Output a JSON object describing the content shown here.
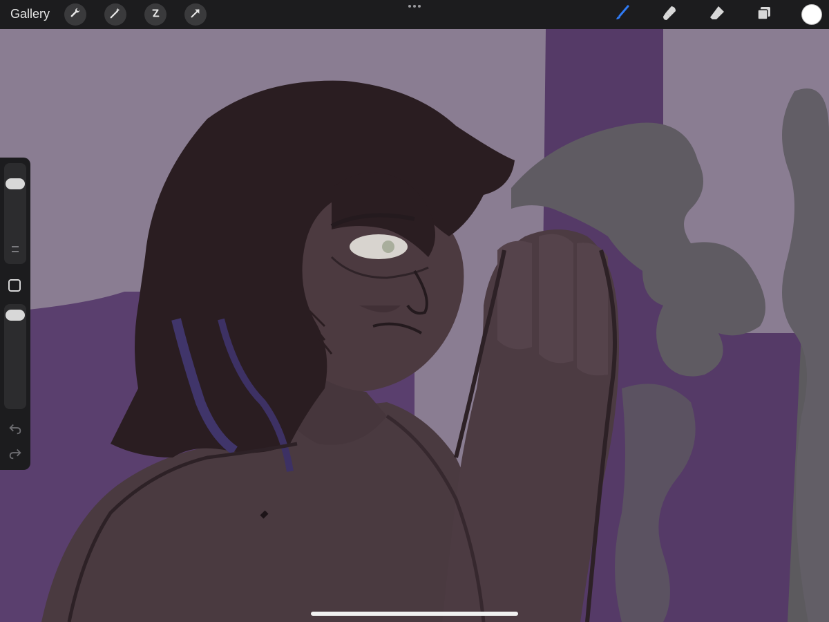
{
  "toolbar": {
    "gallery_label": "Gallery",
    "left_tools": [
      "wrench-icon",
      "magic-wand-icon",
      "selection-icon",
      "transform-arrow-icon"
    ],
    "right_tools": [
      "brush-icon",
      "smudge-icon",
      "eraser-icon",
      "layers-icon"
    ],
    "active_tool": "brush-icon",
    "active_color": "#ffffff",
    "accent_color": "#2f7bf5"
  },
  "sidebar": {
    "controls": [
      "brush-size-slider",
      "modify-button",
      "opacity-slider",
      "undo-arrow-icon",
      "redo-arrow-icon"
    ]
  }
}
